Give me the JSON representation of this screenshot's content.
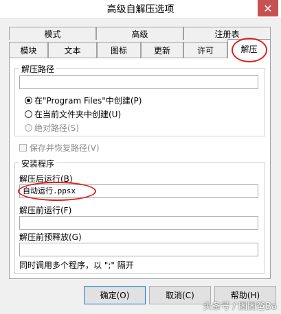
{
  "window": {
    "title": "高级自解压选项",
    "close_glyph": "✕"
  },
  "tabs_row1": [
    "模式",
    "高级",
    "注册表"
  ],
  "tabs_row2": [
    "模块",
    "文本",
    "图标",
    "更新",
    "许可",
    "解压"
  ],
  "active_tab": "解压",
  "path_group": {
    "label": "解压路径",
    "path_value": "",
    "radio_program_files": "在\"Program Files\"中创建(P)",
    "radio_current_folder": "在当前文件夹中创建(U)",
    "radio_absolute": "绝对路径(S)",
    "selected": "radio_program_files"
  },
  "save_restore_label": "保存并恢复路径(V)",
  "setup_group": {
    "label": "安装程序",
    "run_after_label": "解压后运行(B)",
    "run_after_value": "自动运行.ppsx",
    "run_before_label": "解压前运行(F)",
    "run_before_value": "",
    "pre_extract_label": "解压前预释放(G)",
    "pre_extract_value": "",
    "hint": "同时调用多个程序，以 \";\" 隔开"
  },
  "buttons": {
    "ok": "确定(O)",
    "cancel": "取消(C)",
    "help": "帮助(H)"
  },
  "watermark": "头条号 / 图图爸Ba",
  "colors": {
    "annotation_red": "#e0201e",
    "close_red": "#c75050"
  }
}
